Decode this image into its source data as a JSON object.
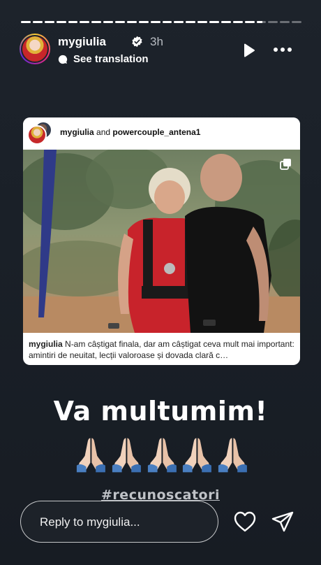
{
  "story": {
    "segments": [
      1,
      1,
      1,
      1,
      1,
      1,
      1,
      1,
      1,
      1,
      1,
      1,
      1,
      1,
      1,
      1,
      1,
      1,
      1,
      1,
      0.6,
      0,
      0,
      0
    ]
  },
  "header": {
    "username": "mygiulia",
    "time": "3h",
    "see_translation": "See translation",
    "icons": {
      "verified": "verified-badge-icon",
      "translation": "translation-bubble-icon",
      "play": "play-icon",
      "more": "more-options-icon"
    }
  },
  "post": {
    "author_1": "mygiulia",
    "and_text": " and ",
    "author_2": "powercouple_antena1",
    "caption_user": "mygiulia",
    "caption_text": " N-am câștigat finala, dar am câștigat ceva mult mai important: amintiri de neuitat, lecții valoroase și dovada clară c…",
    "icons": {
      "multiple": "multiple-photos-icon"
    }
  },
  "overlay": {
    "thanks": "Va multumim!",
    "hands_emoji": [
      "🙏🏼",
      "🙏🏼",
      "🙏🏼",
      "🙏🏼",
      "🙏🏼"
    ],
    "hashtag": "#recunoscatori"
  },
  "footer": {
    "reply_placeholder": "Reply to mygiulia...",
    "icons": {
      "like": "heart-icon",
      "send": "send-icon"
    }
  },
  "colors": {
    "background": "#1b2028",
    "text": "#ffffff",
    "hashtag": "#bfc2c7",
    "verified": "#3897f0"
  }
}
